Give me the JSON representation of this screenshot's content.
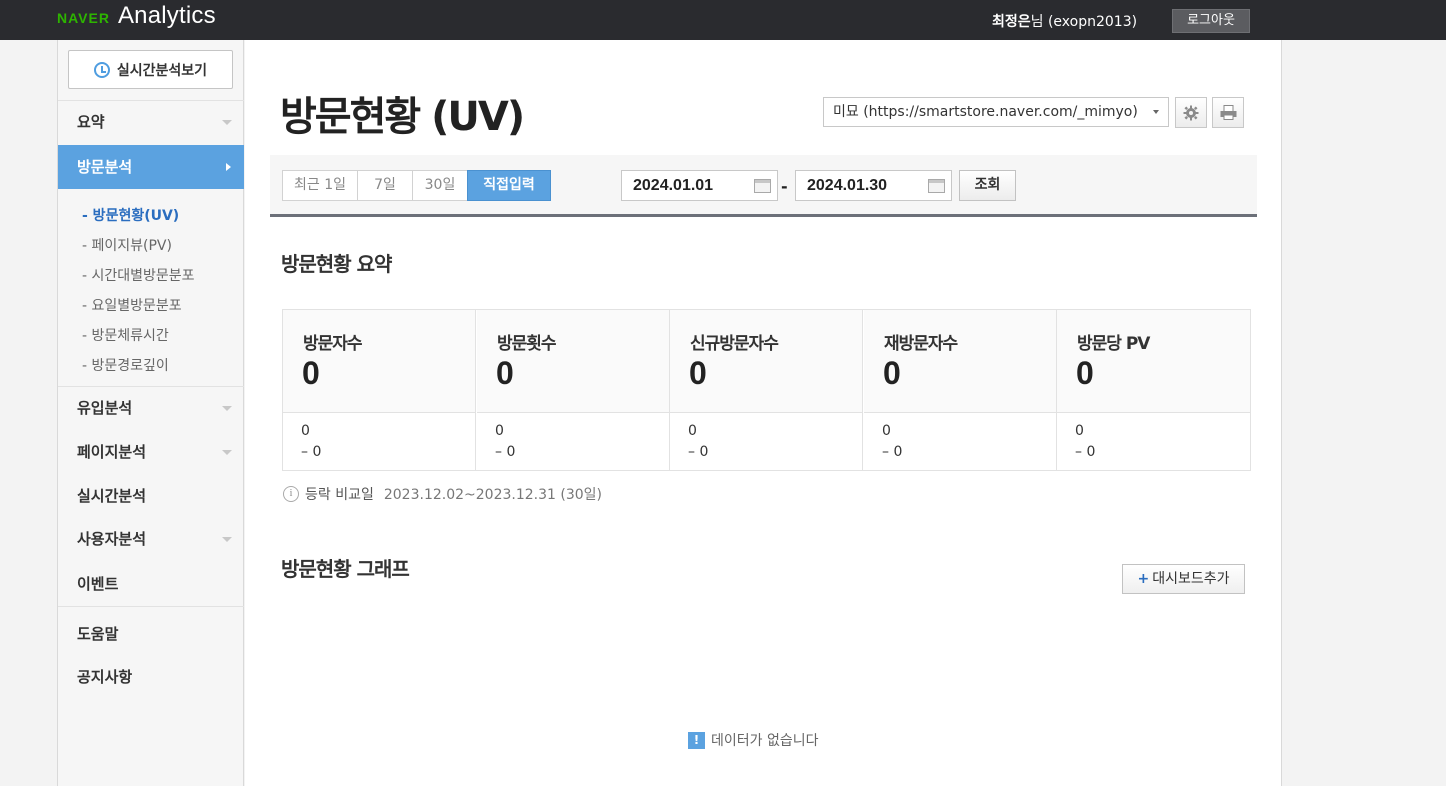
{
  "header": {
    "brand": "NAVER",
    "product": "Analytics",
    "user_name": "최정은",
    "user_suffix": "님 (exopn2013)",
    "logout_label": "로그아웃"
  },
  "sidebar": {
    "realtime_button": "실시간분석보기",
    "items": [
      {
        "label": "요약"
      },
      {
        "label": "방문분석"
      },
      {
        "label": "유입분석"
      },
      {
        "label": "페이지분석"
      },
      {
        "label": "실시간분석"
      },
      {
        "label": "사용자분석"
      },
      {
        "label": "이벤트"
      },
      {
        "label": "도움말"
      },
      {
        "label": "공지사항"
      }
    ],
    "sub_items": [
      {
        "label": "- 방문현황(UV)"
      },
      {
        "label": "- 페이지뷰(PV)"
      },
      {
        "label": "- 시간대별방문분포"
      },
      {
        "label": "- 요일별방문분포"
      },
      {
        "label": "- 방문체류시간"
      },
      {
        "label": "- 방문경로깊이"
      }
    ]
  },
  "main": {
    "title": "방문현황 (UV)",
    "site_selector": "미묘 (https://smartstore.naver.com/_mimyo)",
    "periods": [
      {
        "label": "최근 1일"
      },
      {
        "label": "7일"
      },
      {
        "label": "30일"
      },
      {
        "label": "직접입력"
      }
    ],
    "start_date": "2024.01.01",
    "date_separator": "-",
    "end_date": "2024.01.30",
    "query_label": "조회",
    "summary_title": "방문현황 요약",
    "cards": [
      {
        "label": "방문자수",
        "value": "0",
        "sub1": "0",
        "sub2": "–   0"
      },
      {
        "label": "방문횟수",
        "value": "0",
        "sub1": "0",
        "sub2": "–   0"
      },
      {
        "label": "신규방문자수",
        "value": "0",
        "sub1": "0",
        "sub2": "–   0"
      },
      {
        "label": "재방문자수",
        "value": "0",
        "sub1": "0",
        "sub2": "–   0"
      },
      {
        "label": "방문당 PV",
        "value": "0",
        "sub1": "0",
        "sub2": "–   0"
      }
    ],
    "compare_label": "등락 비교일",
    "compare_range": "2023.12.02~2023.12.31 (30일)",
    "graph_title": "방문현황 그래프",
    "dashboard_add": "대시보드추가",
    "no_data": "데이터가 없습니다"
  }
}
